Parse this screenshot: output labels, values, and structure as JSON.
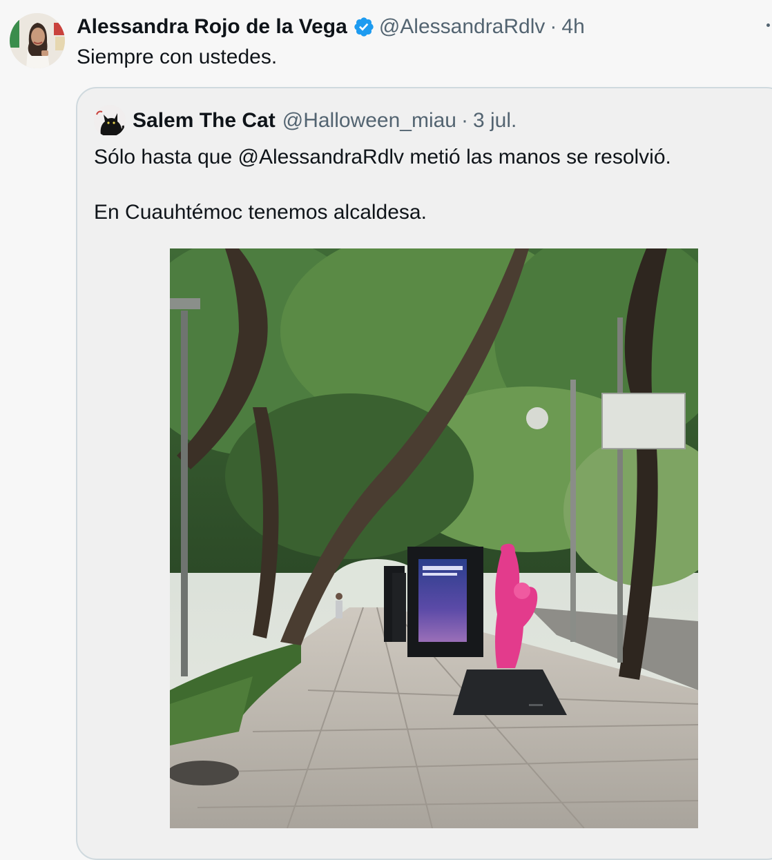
{
  "tweet": {
    "author_name": "Alessandra Rojo de la Vega",
    "handle": "@AlessandraRdlv",
    "separator": "·",
    "time": "4h",
    "text": "Siempre con ustedes.",
    "verified_color": "#1d9bf0",
    "icons": [
      "verified-badge-icon",
      "more-options-icon"
    ]
  },
  "quoted": {
    "author_name": "Salem The Cat",
    "handle": "@Halloween_miau",
    "separator": "·",
    "date": "3 jul.",
    "paragraphs": [
      "Sólo hasta que @AlessandraRdlv metió las manos se resolvió.",
      "En Cuauhtémoc tenemos alcaldesa."
    ]
  },
  "colors": {
    "text_primary": "#0f1419",
    "text_secondary": "#536471",
    "card_border": "#cfd9de",
    "page_background": "#f7f7f7"
  }
}
